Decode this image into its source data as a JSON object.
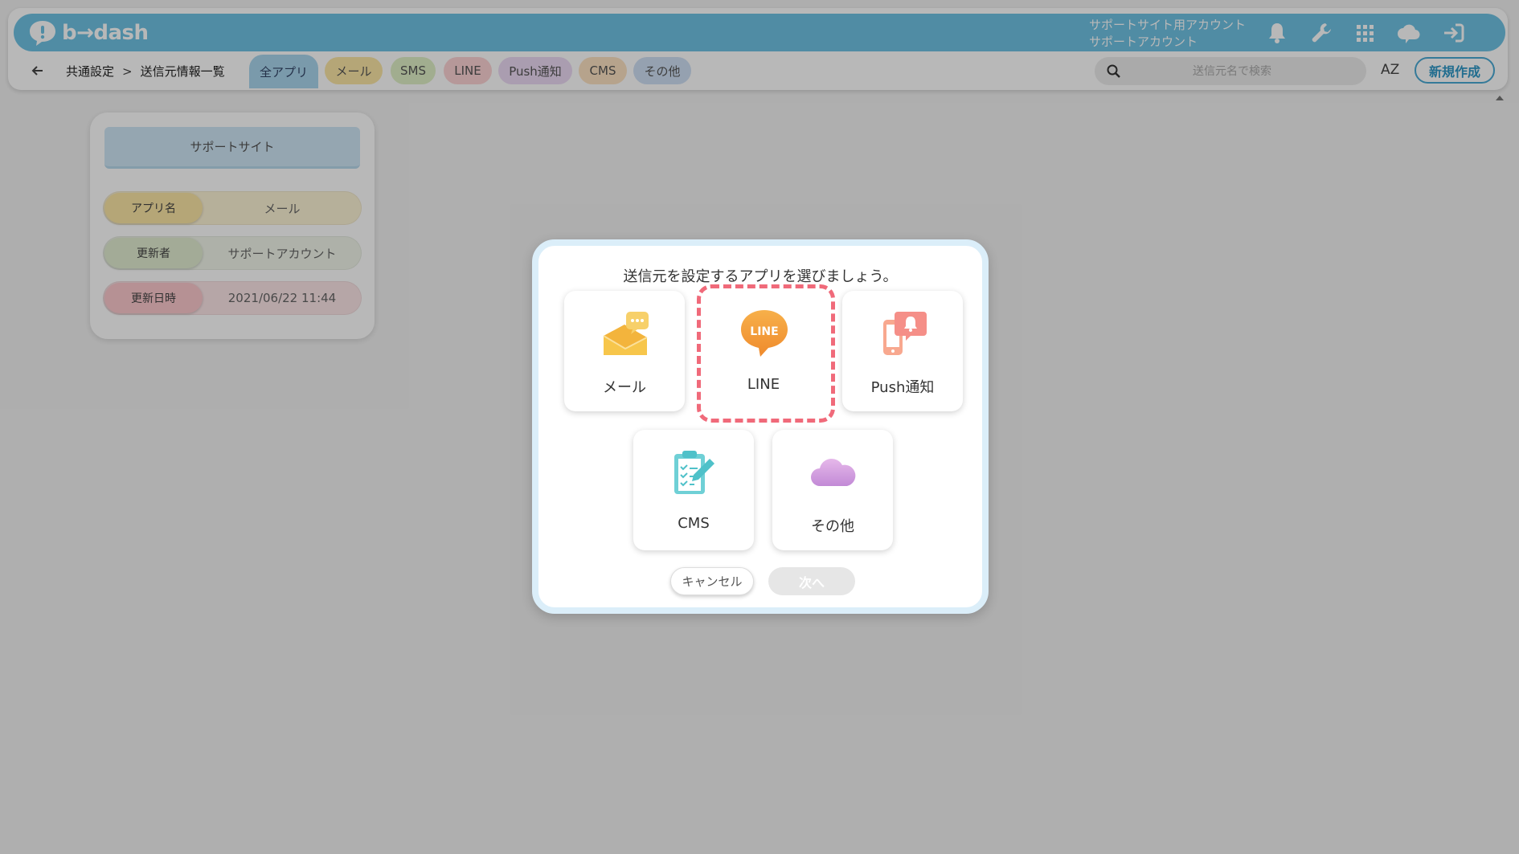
{
  "header": {
    "logo_text": "b→dash",
    "account_line1": "サポートサイト用アカウント",
    "account_line2": "サポートアカウント",
    "bar_color": "#6fc3e4",
    "icons": [
      "bell-icon",
      "wrench-icon",
      "grid-icon",
      "cloud-chat-icon",
      "logout-icon"
    ]
  },
  "breadcrumb": {
    "root": "共通設定",
    "separator": ">",
    "current": "送信元情報一覧"
  },
  "filters": [
    {
      "label": "全アプリ",
      "color": "#a9d6ee",
      "active": true
    },
    {
      "label": "メール",
      "color": "#fbe7a6"
    },
    {
      "label": "SMS",
      "color": "#dff0c6"
    },
    {
      "label": "LINE",
      "color": "#fcd3d5"
    },
    {
      "label": "Push通知",
      "color": "#ecdaf4"
    },
    {
      "label": "CMS",
      "color": "#fde2c2"
    },
    {
      "label": "その他",
      "color": "#cfe0f4"
    }
  ],
  "search": {
    "placeholder": "送信元名で検索",
    "value": ""
  },
  "sort_label": "AZ",
  "new_button": "新規作成",
  "card": {
    "title": "サポートサイト",
    "rows": [
      {
        "label": "アプリ名",
        "value": "メール",
        "label_color": "#fbe7a6",
        "value_color": "#fdf4d6"
      },
      {
        "label": "更新者",
        "value": "サポートアカウント",
        "label_color": "#e2eed2",
        "value_color": "#f1f6ea"
      },
      {
        "label": "更新日時",
        "value": "2021/06/22 11:44",
        "label_color": "#fcc9ce",
        "value_color": "#fde6e8"
      }
    ]
  },
  "modal": {
    "title": "送信元を設定するアプリを選びましょう。",
    "options": [
      {
        "label": "メール",
        "icon": "mail-icon",
        "color": "#f7c64b"
      },
      {
        "label": "LINE",
        "icon": "line-icon",
        "color": "#f49a3c",
        "selected": true,
        "icon_text": "LINE"
      },
      {
        "label": "Push通知",
        "icon": "push-notification-icon",
        "color": "#f58f88"
      },
      {
        "label": "CMS",
        "icon": "cms-clipboard-icon",
        "color": "#4fc1c9"
      },
      {
        "label": "その他",
        "icon": "cloud-icon",
        "color": "#c890d8"
      }
    ],
    "cancel_label": "キャンセル",
    "next_label": "次へ",
    "highlight_color": "#f06a7a"
  }
}
